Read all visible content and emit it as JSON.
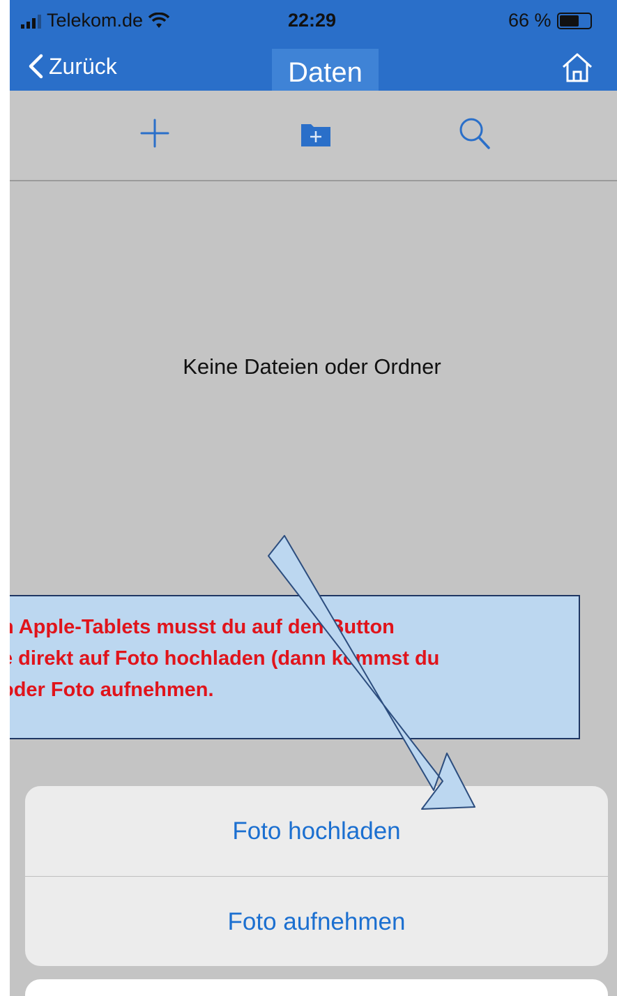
{
  "status_bar": {
    "carrier": "Telekom.de",
    "time": "22:29",
    "battery": "66 %",
    "battery_level": 0.66
  },
  "nav": {
    "back_label": "Zurück",
    "title": "Daten"
  },
  "toolbar": {
    "icons": [
      "plus-icon",
      "new-folder-icon",
      "search-icon"
    ]
  },
  "content": {
    "empty_message": "Keine Dateien oder Ordner"
  },
  "callout": {
    "line1": "h Apple-Tablets musst du auf den Button",
    "line2": "e direkt auf Foto hochladen (dann kommst du",
    "line3": "oder Foto aufnehmen."
  },
  "action_sheet": {
    "upload_label": "Foto hochladen",
    "capture_label": "Foto aufnehmen"
  },
  "colors": {
    "accent": "#2a6fc9",
    "action_text": "#1b6fd0",
    "callout_text": "#e0141b",
    "callout_bg": "#bcd7f0"
  }
}
